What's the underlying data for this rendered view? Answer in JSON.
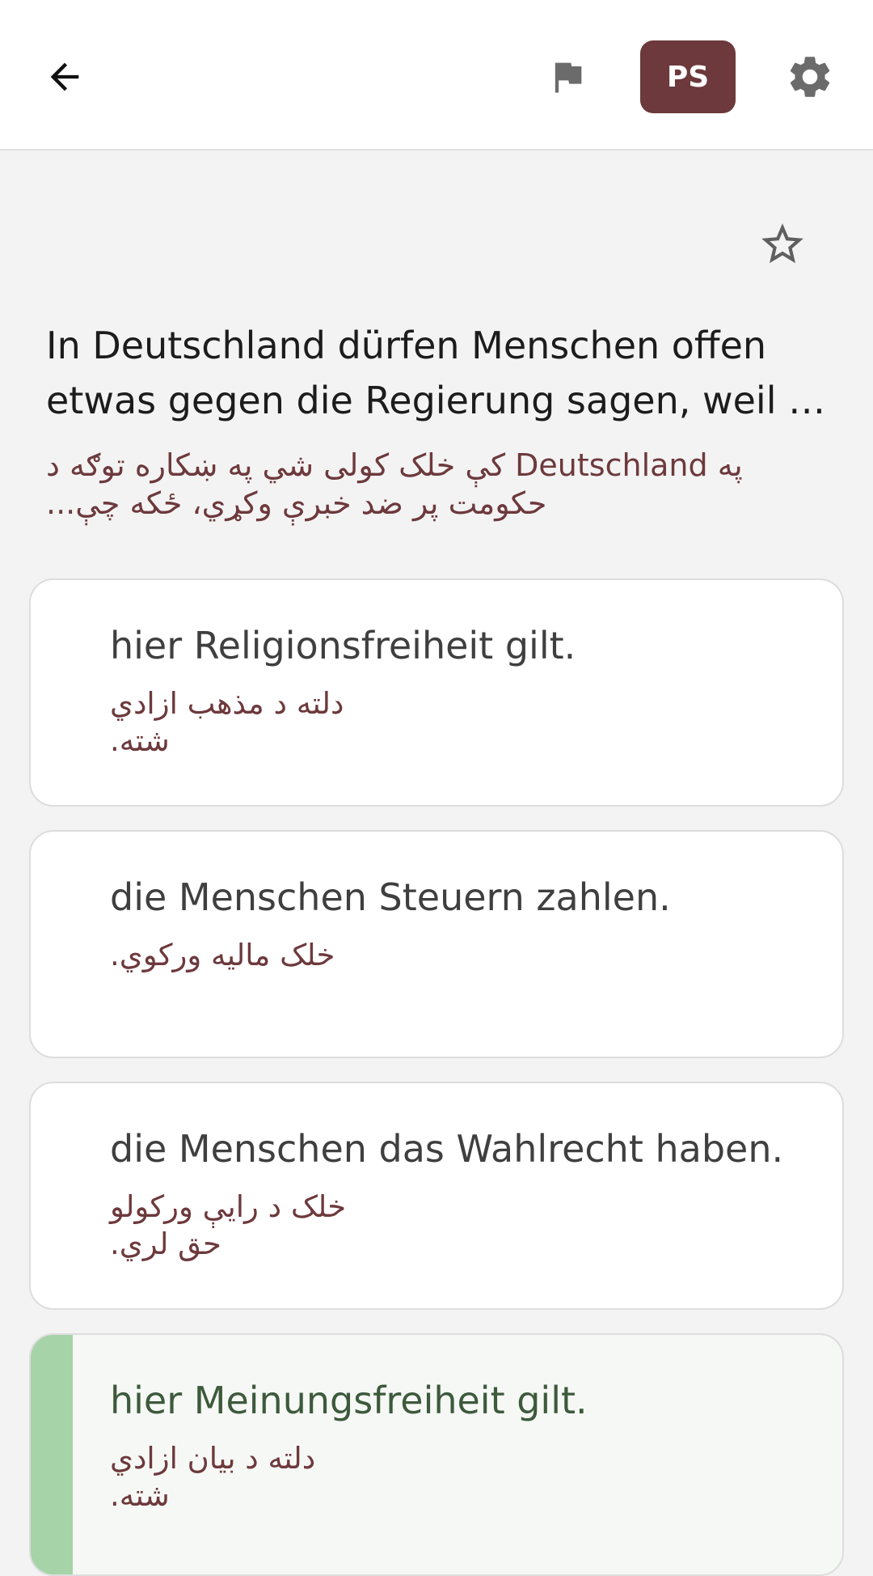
{
  "header": {
    "back_icon": "arrow-left-icon",
    "flag_icon": "flag-icon",
    "language_label": "PS",
    "settings_icon": "gear-icon",
    "accent_color": "#6d393c"
  },
  "question": {
    "favorite_icon": "star-outline-icon",
    "text": "In Deutschland dürfen Menschen offen etwas gegen die Regierung sagen, weil …",
    "translation": "په Deutschland کې خلک کولی شي په ښکاره توګه د حکومت پر ضد خبرې وکړي، ځکه چې..."
  },
  "answers": [
    {
      "text": "hier Religionsfreiheit gilt.",
      "translation": "دلته د مذهب ازادي شته.",
      "correct": false
    },
    {
      "text": "die Menschen Steuern zahlen.",
      "translation": "خلک مالیه ورکوي.",
      "correct": false
    },
    {
      "text": "die Menschen das Wahlrecht haben.",
      "translation": "خلک د رایې ورکولو حق لري.",
      "correct": false
    },
    {
      "text": "hier Meinungsfreiheit gilt.",
      "translation": "دلته د بیان ازادي شته.",
      "correct": true,
      "correct_color": "#a6d3a8"
    }
  ]
}
